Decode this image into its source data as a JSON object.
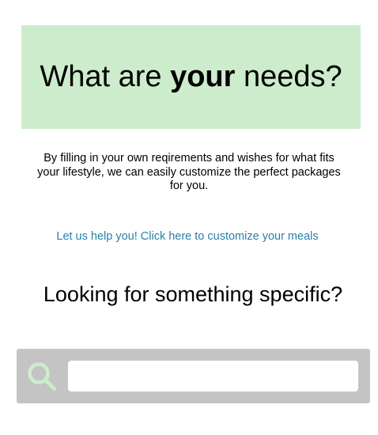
{
  "hero": {
    "title_before": "What are ",
    "title_emphasis": "your",
    "title_after": " needs?",
    "background_color": "#cdeccc"
  },
  "intro": {
    "text": "By filling in your own reqirements and wishes for what fits your lifestyle, we can easily customize the perfect packages for you."
  },
  "cta": {
    "link_text": "Let us help you! Click here to customize your meals",
    "link_color": "#2a7fa6"
  },
  "specific": {
    "heading": "Looking for something specific?"
  },
  "search": {
    "value": "",
    "placeholder": "",
    "icon": "search-icon",
    "icon_color": "#cdeccc",
    "bar_color": "#c4c4c4"
  }
}
